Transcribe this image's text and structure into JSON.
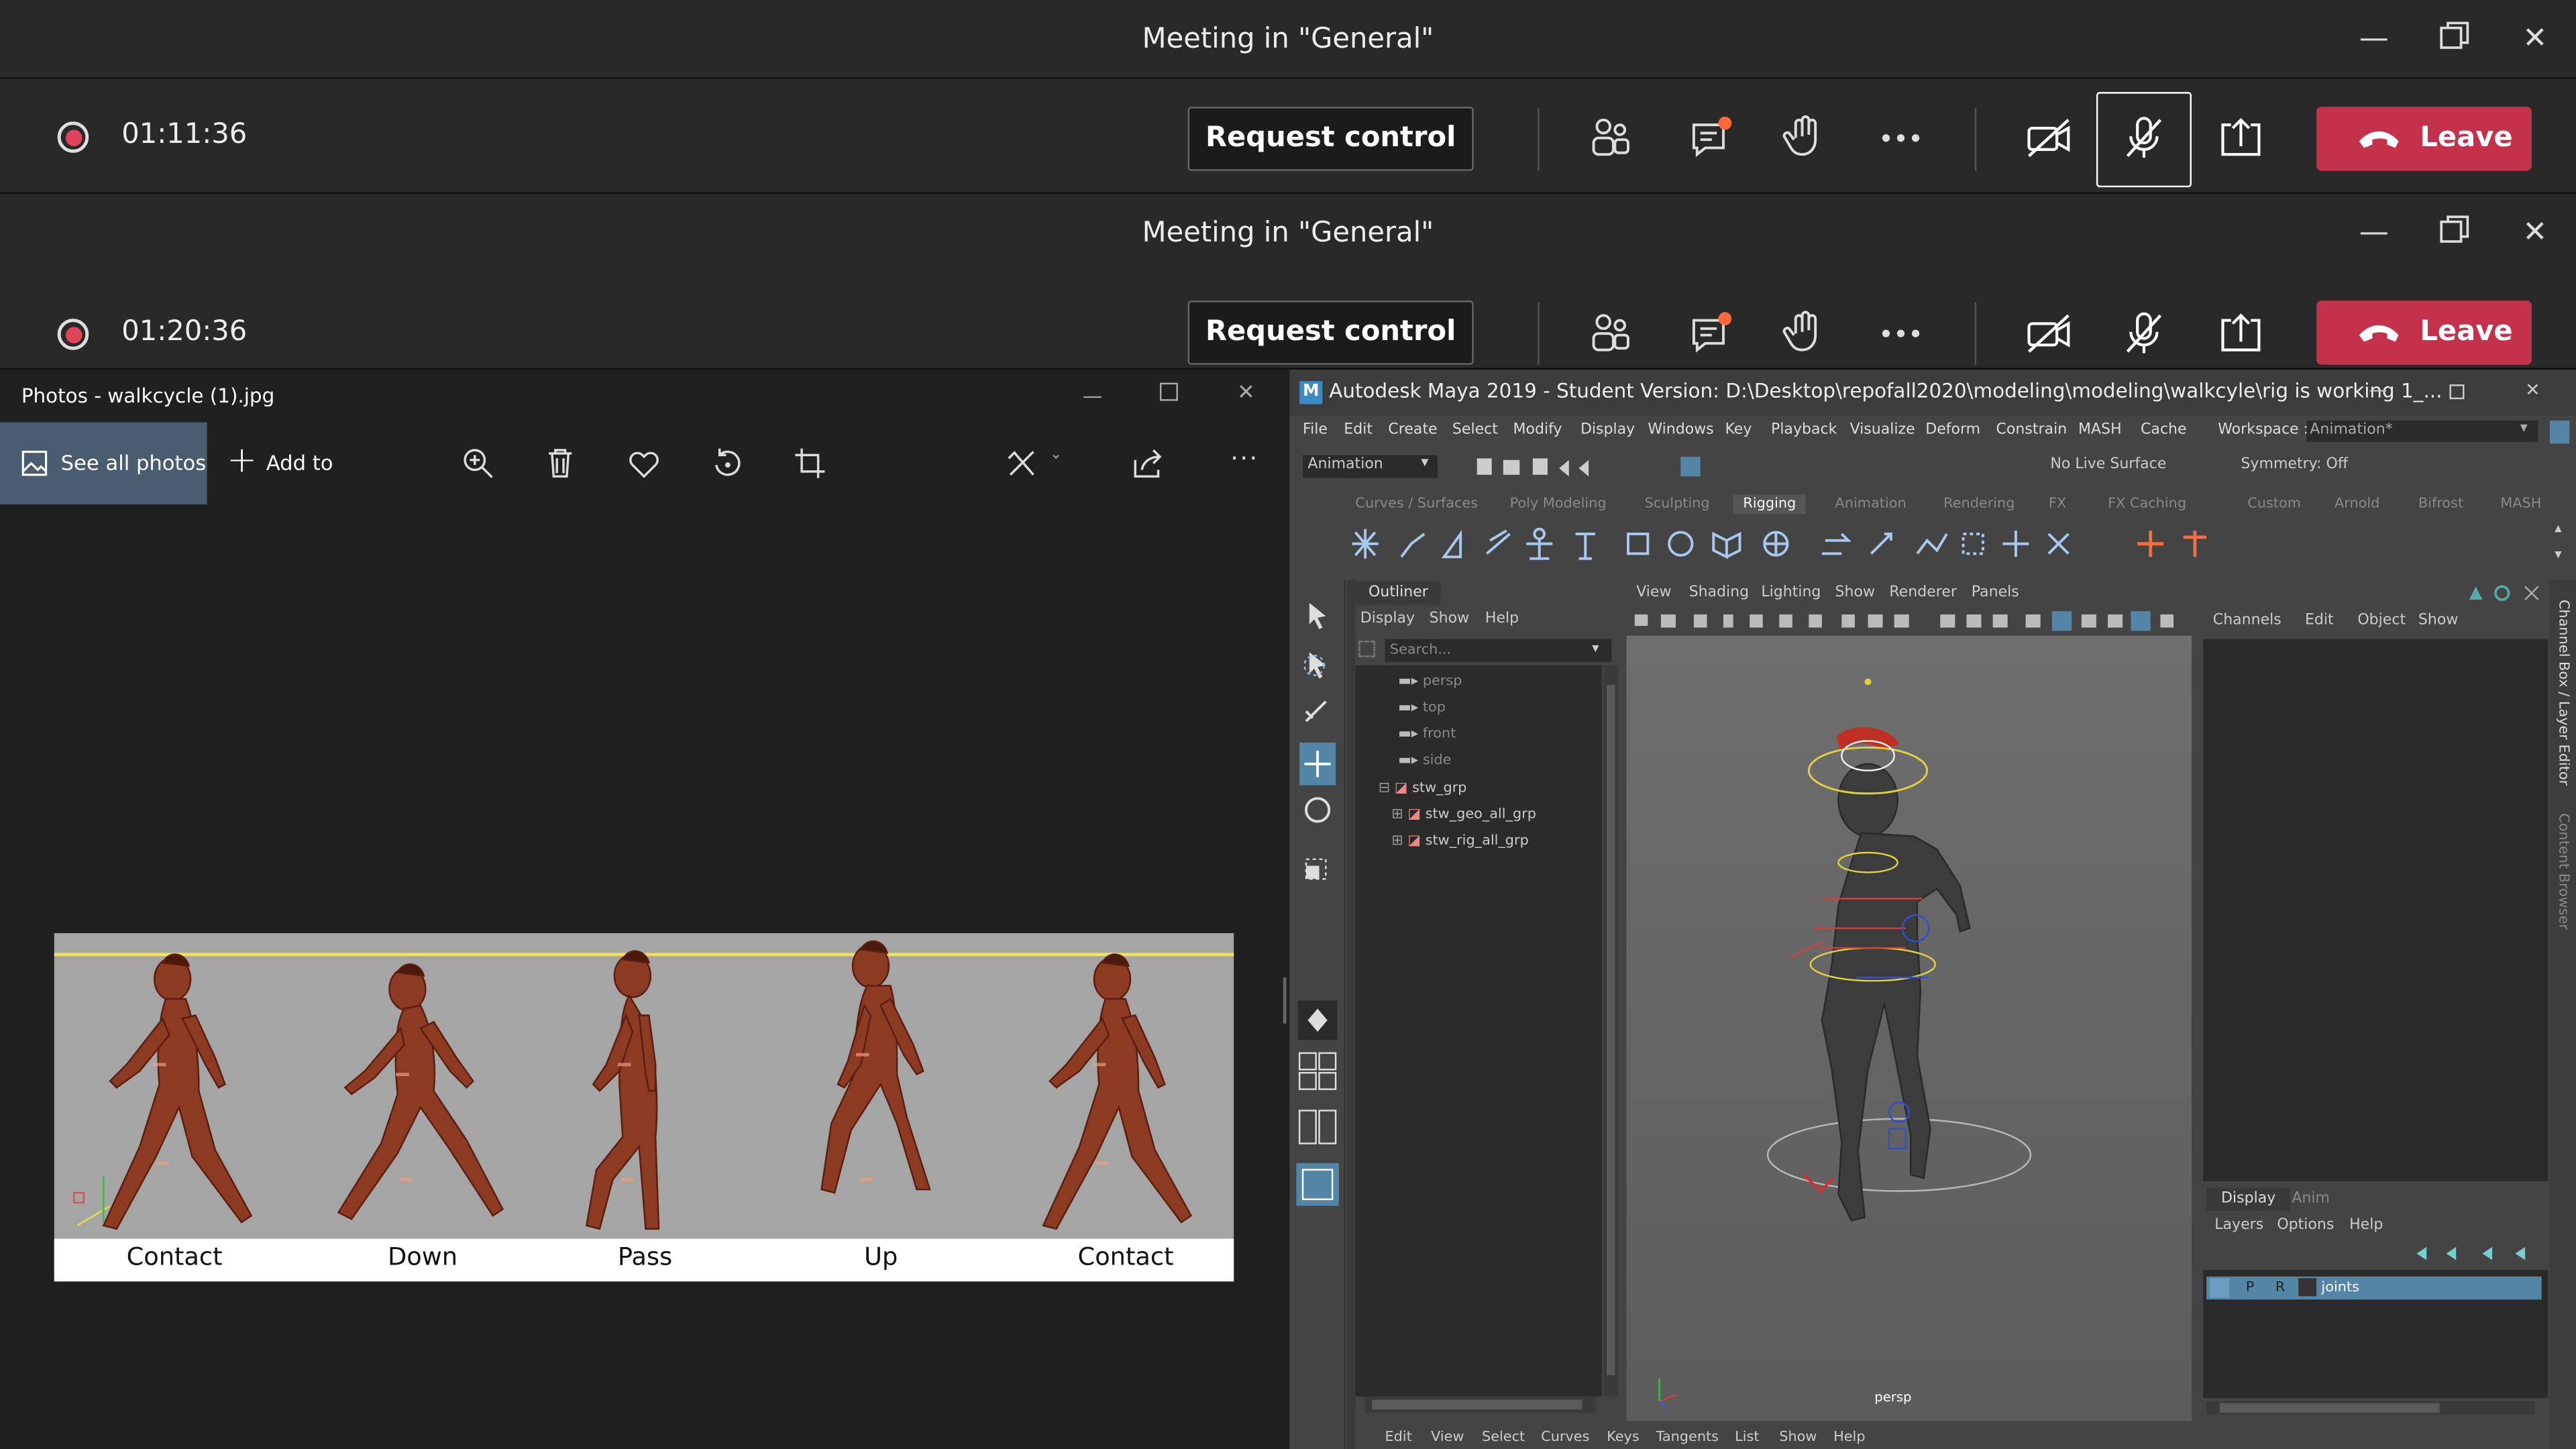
{
  "teams": [
    {
      "title": "Meeting in \"General\"",
      "timer": "01:11:36",
      "request_label": "Request control",
      "leave_label": "Leave"
    },
    {
      "title": "Meeting in \"General\"",
      "timer": "01:20:36",
      "request_label": "Request control",
      "leave_label": "Leave"
    }
  ],
  "teams_icons": [
    "participants-icon",
    "chat-icon",
    "raise-hand-icon",
    "more-icon",
    "camera-off-icon",
    "mic-off-icon",
    "share-screen-icon"
  ],
  "colors": {
    "leave": "#c4314b",
    "record": "#e0445a",
    "maya_accent": "#5285a6"
  },
  "photos": {
    "title": "Photos - walkcycle (1).jpg",
    "see_all": "See all photos",
    "add_to": "Add to",
    "frames": [
      "Contact",
      "Down",
      "Pass",
      "Up",
      "Contact"
    ]
  },
  "maya": {
    "title": "Autodesk Maya 2019 - Student Version: D:\\Desktop\\repofall2020\\modeling\\modeling\\walkcyle\\rig is working 1_...",
    "menu": [
      "File",
      "Edit",
      "Create",
      "Select",
      "Modify",
      "Display",
      "Windows",
      "Key",
      "Playback",
      "Visualize",
      "Deform",
      "Constrain",
      "MASH",
      "Cache"
    ],
    "workspace_label": "Workspace :",
    "workspace_value": "Animation*",
    "mode": "Animation",
    "live_surface": "No Live Surface",
    "symmetry": "Symmetry: Off",
    "shelf_tabs": [
      "Curves / Surfaces",
      "Poly Modeling",
      "Sculpting",
      "Rigging",
      "Animation",
      "Rendering",
      "FX",
      "FX Caching",
      "Custom",
      "Arnold",
      "Bifrost",
      "MASH"
    ],
    "outliner": {
      "title": "Outliner",
      "menu": [
        "Display",
        "Show",
        "Help"
      ],
      "search": "Search...",
      "items": [
        "persp",
        "top",
        "front",
        "side",
        "stw_grp",
        "stw_geo_all_grp",
        "stw_rig_all_grp"
      ]
    },
    "viewport": {
      "menu": [
        "View",
        "Shading",
        "Lighting",
        "Show",
        "Renderer",
        "Panels"
      ],
      "camera": "persp"
    },
    "channel_box": {
      "menu": [
        "Channels",
        "Edit",
        "Object",
        "Show"
      ],
      "side_tabs": [
        "Channel Box / Layer Editor",
        "Content Browser"
      ]
    },
    "layer_editor": {
      "tabs": [
        "Display",
        "Anim"
      ],
      "menu": [
        "Layers",
        "Options",
        "Help"
      ],
      "layer": {
        "p": "P",
        "r": "R",
        "name": "joints"
      }
    },
    "graph_menu": [
      "Edit",
      "View",
      "Select",
      "Curves",
      "Keys",
      "Tangents",
      "List",
      "Show",
      "Help"
    ]
  }
}
